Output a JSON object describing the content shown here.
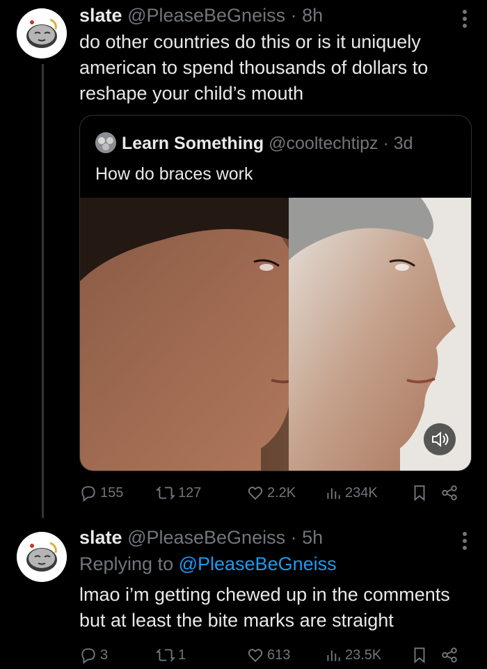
{
  "tweet1": {
    "name": "slate",
    "handle": "@PleaseBeGneiss",
    "separator": "·",
    "time": "8h",
    "text": "do other countries do this or is it uniquely american to spend thousands of dollars to reshape your child’s mouth",
    "quote": {
      "name": "Learn Something",
      "handle": "@cooltechtipz",
      "separator": "·",
      "time": "3d",
      "text": "How do braces work"
    },
    "stats": {
      "replies": "155",
      "reposts": "127",
      "likes": "2.2K",
      "views": "234K"
    }
  },
  "tweet2": {
    "name": "slate",
    "handle": "@PleaseBeGneiss",
    "separator": "·",
    "time": "5h",
    "replying_prefix": "Replying to ",
    "replying_to": "@PleaseBeGneiss",
    "text": "lmao i’m getting chewed up in the comments but at least the bite marks are straight",
    "stats": {
      "replies": "3",
      "reposts": "1",
      "likes": "613",
      "views": "23.5K"
    }
  },
  "colors": {
    "background": "#000000",
    "text": "#e7e9ea",
    "muted": "#71767b",
    "link": "#1d9bf0",
    "border": "#2f3336"
  },
  "icons": {
    "reply": "reply-icon",
    "repost": "repost-icon",
    "like": "heart-icon",
    "views": "views-icon",
    "bookmark": "bookmark-icon",
    "share": "share-icon",
    "more": "more-icon",
    "sound": "speaker-icon"
  }
}
